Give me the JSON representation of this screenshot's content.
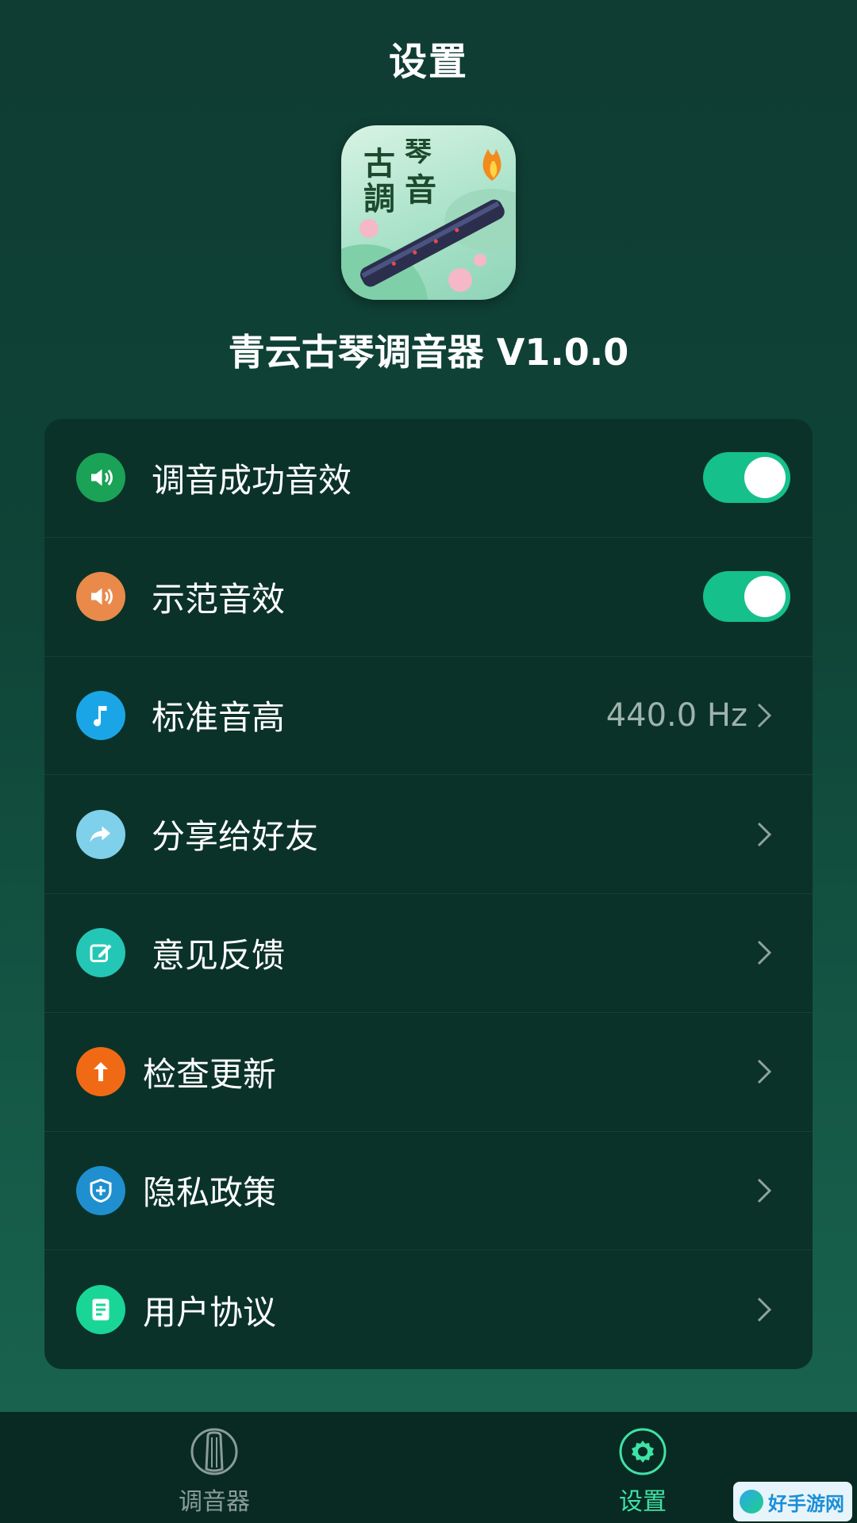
{
  "header": {
    "title": "设置"
  },
  "app": {
    "icon_text_1": "古",
    "icon_text_2": "琴",
    "icon_text_3": "調",
    "icon_text_4": "音",
    "name": "青云古琴调音器 V1.0.0"
  },
  "settings": [
    {
      "label": "调音成功音效",
      "icon": "speaker-icon",
      "icon_color": "#1aa257",
      "control": "toggle",
      "on": true
    },
    {
      "label": "示范音效",
      "icon": "speaker-icon",
      "icon_color": "#e98a4a",
      "control": "toggle",
      "on": true
    },
    {
      "label": "标准音高",
      "icon": "music-note-icon",
      "icon_color": "#1aa6e6",
      "control": "value",
      "value": "440.0 Hz"
    },
    {
      "label": "分享给好友",
      "icon": "share-icon",
      "icon_color": "#7fd0ea",
      "control": "chevron"
    },
    {
      "label": "意见反馈",
      "icon": "edit-icon",
      "icon_color": "#24c7b5",
      "control": "chevron"
    },
    {
      "label": "检查更新",
      "icon": "arrow-up-icon",
      "icon_color": "#f06a16",
      "control": "chevron"
    },
    {
      "label": "隐私政策",
      "icon": "shield-icon",
      "icon_color": "#1f8fd0",
      "control": "chevron"
    },
    {
      "label": "用户协议",
      "icon": "document-icon",
      "icon_color": "#19d697",
      "control": "chevron"
    }
  ],
  "tabs": [
    {
      "label": "调音器",
      "icon": "guqin-icon",
      "active": false
    },
    {
      "label": "设置",
      "icon": "gear-icon",
      "active": true
    }
  ],
  "watermark": {
    "text": "好手游网"
  },
  "colors": {
    "accent": "#16c08a",
    "active_tab": "#3fe2a6"
  }
}
